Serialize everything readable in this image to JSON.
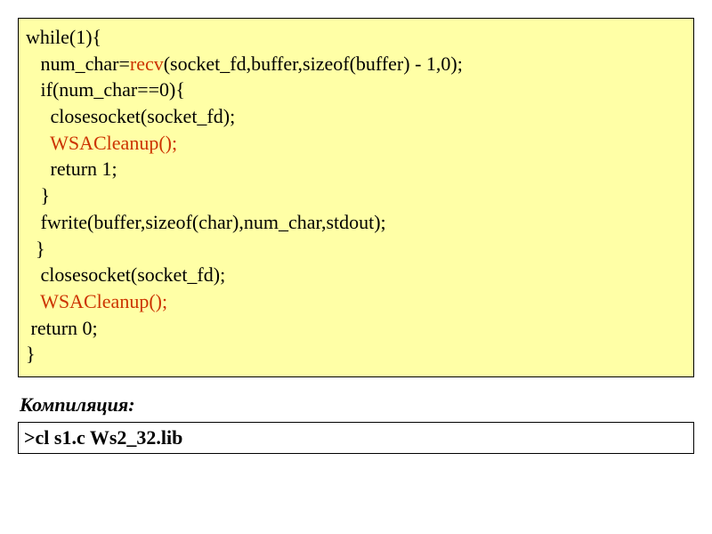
{
  "code": {
    "l1a": "while(1){",
    "l2a": "   num_char=",
    "l2b": "recv",
    "l2c": "(socket_fd,buffer,sizeof(buffer) - 1,0);",
    "l3": "   if(num_char==0){",
    "l4": "     closesocket(socket_fd);",
    "l5a": "     ",
    "l5b": "WSACleanup();",
    "l6": "     return 1;",
    "l7": "   }",
    "l8": "   fwrite(buffer,sizeof(char),num_char,stdout);",
    "l9": "  }",
    "l10": "   closesocket(socket_fd);",
    "l11a": "   ",
    "l11b": "WSACleanup();",
    "l12": " return 0;",
    "l13": "}"
  },
  "compile_label": "Компиляция:",
  "compile_cmd": ">cl  s1.c  Ws2_32.lib"
}
